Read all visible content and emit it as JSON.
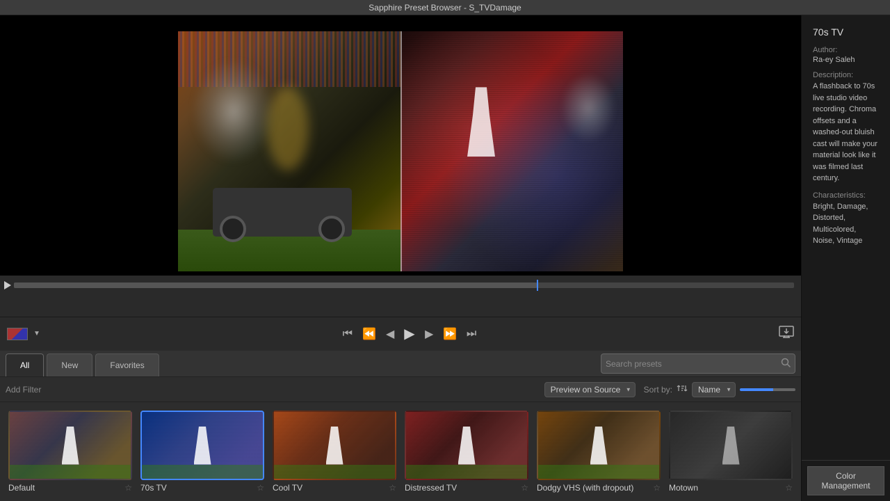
{
  "titleBar": {
    "text": "Sapphire Preset Browser - S_TVDamage"
  },
  "tabs": {
    "all": "All",
    "new": "New",
    "favorites": "Favorites"
  },
  "search": {
    "placeholder": "Search presets"
  },
  "filterRow": {
    "addFilter": "Add Filter",
    "previewLabel": "Preview on Source",
    "sortLabel": "Sort by:",
    "sortName": "Name"
  },
  "presets": [
    {
      "id": "default",
      "name": "Default",
      "thumb": "default",
      "selected": false
    },
    {
      "id": "70stv",
      "name": "70s TV",
      "thumb": "70stv",
      "selected": true
    },
    {
      "id": "cooltv",
      "name": "Cool TV",
      "thumb": "cooltv",
      "selected": false
    },
    {
      "id": "distressedtv",
      "name": "Distressed TV",
      "thumb": "distressed",
      "selected": false
    },
    {
      "id": "dodgyvhs",
      "name": "Dodgy VHS (with dropout)",
      "thumb": "dodgy",
      "selected": false
    },
    {
      "id": "motown",
      "name": "Motown",
      "thumb": "motown",
      "selected": false
    }
  ],
  "presetInfo": {
    "title": "70s TV",
    "authorLabel": "Author:",
    "authorValue": "Ra-ey Saleh",
    "descLabel": "Description:",
    "descValue": "A flashback to 70s live studio video recording.  Chroma offsets and a washed-out bluish cast will make your material look like it was filmed last century.",
    "charLabel": "Characteristics:",
    "charValue": "Bright, Damage, Distorted, Multicolored, Noise, Vintage"
  },
  "colorMgmt": {
    "label": "Color Management"
  },
  "transport": {
    "skipBack": "⏮",
    "back": "⏪",
    "stepBack": "◀",
    "play": "▶",
    "stepFwd": "▶",
    "fwd": "⏩",
    "skipFwd": "⏭"
  }
}
